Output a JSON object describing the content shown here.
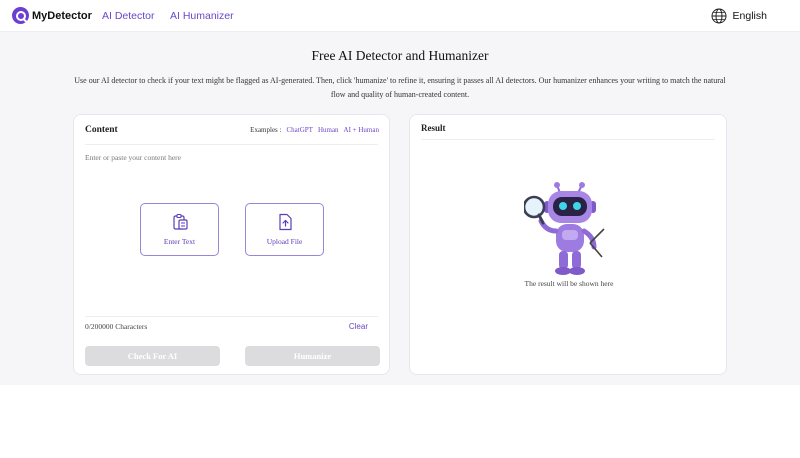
{
  "header": {
    "brand": "MyDetector",
    "nav": [
      {
        "label": "AI Detector"
      },
      {
        "label": "AI Humanizer"
      }
    ],
    "language": "English"
  },
  "page": {
    "title": "Free AI Detector and Humanizer",
    "description": "Use our AI detector to check if your text might be flagged as AI-generated. Then, click 'humanize' to refine it, ensuring it passes all AI detectors. Our humanizer enhances your writing to match the natural flow and quality of human-created content."
  },
  "content_panel": {
    "title": "Content",
    "examples_label": "Examples :",
    "examples": [
      "ChatGPT",
      "Human",
      "AI + Human"
    ],
    "placeholder": "Enter or paste your content here",
    "enter_text_label": "Enter Text",
    "upload_file_label": "Upload File",
    "char_count": "0/200000 Characters",
    "clear_label": "Clear",
    "check_button": "Check For AI",
    "humanize_button": "Humanize"
  },
  "result_panel": {
    "title": "Result",
    "empty_message": "The result will be shown here"
  },
  "colors": {
    "accent": "#6a47c9",
    "disabled_button": "#dcdcdf",
    "page_background": "#f6f6f9"
  }
}
